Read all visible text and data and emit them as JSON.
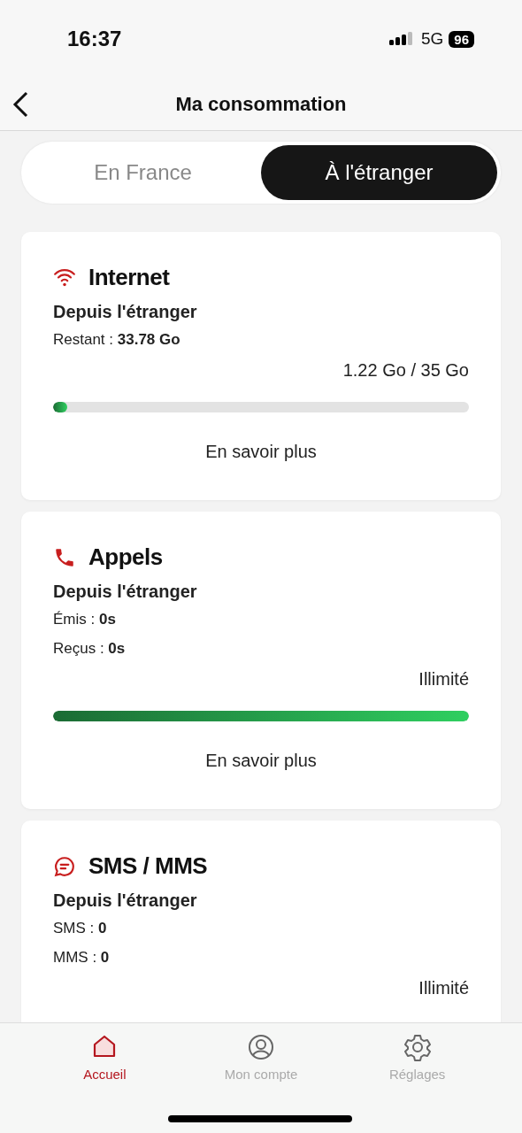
{
  "status_bar": {
    "time": "16:37",
    "network": "5G",
    "battery": "96"
  },
  "header": {
    "title": "Ma consommation"
  },
  "segments": [
    {
      "label": "En France",
      "selected": false
    },
    {
      "label": "À l'étranger",
      "selected": true
    }
  ],
  "cards": [
    {
      "kind": "internet",
      "title": "Internet",
      "subtitle": "Depuis l'étranger",
      "lines": [
        "Restant : **33.78 Go**"
      ],
      "usage": "1.22 Go / 35 Go",
      "level": 0.035,
      "link": "En savoir plus"
    },
    {
      "kind": "calls",
      "title": "Appels",
      "subtitle": "Depuis l'étranger",
      "lines": [
        "Émis : **0s**",
        "Reçus : **0s**"
      ],
      "usage": "Illimité",
      "level": 1,
      "link": "En savoir plus"
    },
    {
      "kind": "sms",
      "title": "SMS / MMS",
      "subtitle": "Depuis l'étranger",
      "lines": [
        "SMS : **0**",
        "MMS : **0**"
      ],
      "usage": "Illimité"
    }
  ],
  "tab_bar": [
    {
      "kind": "home",
      "label": "Accueil",
      "selected": true
    },
    {
      "kind": "account",
      "label": "Mon compte",
      "selected": false
    },
    {
      "kind": "settings",
      "label": "Réglages",
      "selected": false
    }
  ]
}
